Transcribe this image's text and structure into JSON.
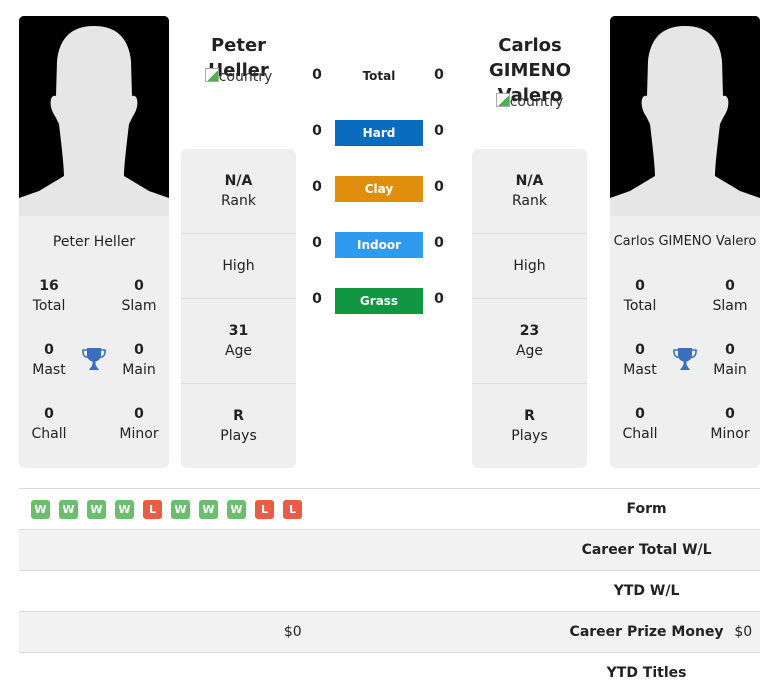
{
  "colors": {
    "hard": "#0a6cbf",
    "clay": "#df8f0b",
    "indoor": "#2e9bf0",
    "grass": "#119742",
    "win": "#6abf6e",
    "loss": "#eb5b45",
    "trophy": "#3a6fbf"
  },
  "player1": {
    "name": "Peter Heller",
    "country_alt": "country",
    "titles": {
      "total": {
        "value": "16",
        "label": "Total"
      },
      "slam": {
        "value": "0",
        "label": "Slam"
      },
      "mast": {
        "value": "0",
        "label": "Mast"
      },
      "main": {
        "value": "0",
        "label": "Main"
      },
      "chall": {
        "value": "0",
        "label": "Chall"
      },
      "minor": {
        "value": "0",
        "label": "Minor"
      }
    },
    "info": {
      "rank": {
        "value": "N/A",
        "label": "Rank"
      },
      "high": {
        "label": "High"
      },
      "age": {
        "value": "31",
        "label": "Age"
      },
      "plays": {
        "value": "R",
        "label": "Plays"
      }
    }
  },
  "player2": {
    "name": "Carlos GIMENO Valero",
    "country_alt": "country",
    "titles": {
      "total": {
        "value": "0",
        "label": "Total"
      },
      "slam": {
        "value": "0",
        "label": "Slam"
      },
      "mast": {
        "value": "0",
        "label": "Mast"
      },
      "main": {
        "value": "0",
        "label": "Main"
      },
      "chall": {
        "value": "0",
        "label": "Chall"
      },
      "minor": {
        "value": "0",
        "label": "Minor"
      }
    },
    "info": {
      "rank": {
        "value": "N/A",
        "label": "Rank"
      },
      "high": {
        "label": "High"
      },
      "age": {
        "value": "23",
        "label": "Age"
      },
      "plays": {
        "value": "R",
        "label": "Plays"
      }
    }
  },
  "h2h": {
    "total": {
      "label": "Total",
      "p1": "0",
      "p2": "0"
    },
    "hard": {
      "label": "Hard",
      "p1": "0",
      "p2": "0"
    },
    "clay": {
      "label": "Clay",
      "p1": "0",
      "p2": "0"
    },
    "indoor": {
      "label": "Indoor",
      "p1": "0",
      "p2": "0"
    },
    "grass": {
      "label": "Grass",
      "p1": "0",
      "p2": "0"
    }
  },
  "form": {
    "label": "Form",
    "p1": [
      "W",
      "W",
      "W",
      "W",
      "L",
      "W",
      "W",
      "W",
      "L",
      "L"
    ]
  },
  "rows": {
    "career_wl": {
      "label": "Career Total W/L",
      "p1": "",
      "p2": ""
    },
    "ytd_wl": {
      "label": "YTD W/L",
      "p1": "",
      "p2": ""
    },
    "prize": {
      "label": "Career Prize Money",
      "p1": "$0",
      "p2": "$0"
    },
    "ytd_titles": {
      "label": "YTD Titles",
      "p1": "",
      "p2": ""
    }
  }
}
